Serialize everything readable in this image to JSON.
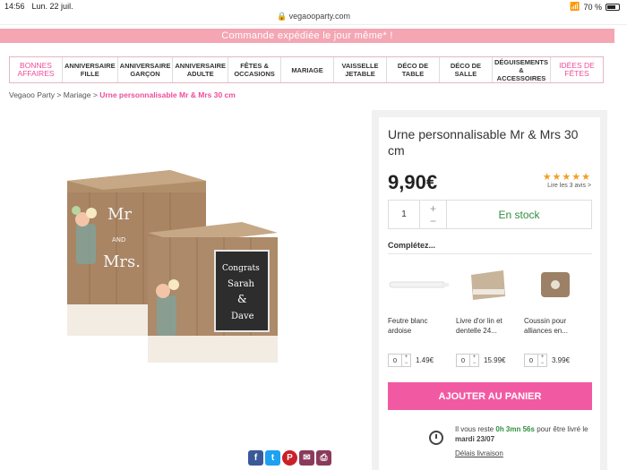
{
  "status": {
    "time": "14:56",
    "date": "Lun. 22 juil.",
    "url": "vegaooparty.com",
    "battery": "70 %"
  },
  "promo": "Commande expédiée le jour même* !",
  "nav": [
    {
      "label": "BONNES AFFAIRES",
      "pink": true
    },
    {
      "label": "ANNIVERSAIRE FILLE"
    },
    {
      "label": "ANNIVERSAIRE GARÇON"
    },
    {
      "label": "ANNIVERSAIRE ADULTE"
    },
    {
      "label": "FÊTES & OCCASIONS"
    },
    {
      "label": "MARIAGE"
    },
    {
      "label": "VAISSELLE JETABLE"
    },
    {
      "label": "DÉCO DE TABLE"
    },
    {
      "label": "DÉCO DE SALLE"
    },
    {
      "label": "DÉGUISEMENTS & ACCESSOIRES"
    },
    {
      "label": "IDÉES DE FÊTES",
      "pink": true
    }
  ],
  "breadcrumb": {
    "home": "Vegaoo Party",
    "sep": ">",
    "category": "Mariage",
    "current": "Urne personnalisable Mr & Mrs 30 cm"
  },
  "product": {
    "title": "Urne personnalisable Mr & Mrs 30 cm",
    "price": "9,90€",
    "stars": "★★★★★",
    "rating": 5,
    "reviews": "Lire les 3 avis >",
    "qty": "1",
    "plus": "+",
    "minus": "−",
    "stock": "En stock",
    "image_text": {
      "mr": "Mr",
      "and": "AND",
      "mrs": "Mrs.",
      "congrats": "Congrats",
      "name1": "Sarah",
      "amp": "&",
      "name2": "Dave"
    }
  },
  "completez": "Complétez...",
  "addons": [
    {
      "name": "Feutre blanc ardoise",
      "qty": "0",
      "price": "1.49€"
    },
    {
      "name": "Livre d'or lin et dentelle 24...",
      "qty": "0",
      "price": "15.99€"
    },
    {
      "name": "Coussin pour alliances en...",
      "qty": "0",
      "price": "3.99€"
    }
  ],
  "add_to_cart": "AJOUTER AU PANIER",
  "delivery": {
    "before": "Il vous reste",
    "countdown": "0h 3mn 56s",
    "after": "pour être livré le",
    "day": "mardi 23/07",
    "link": "Délais livraison"
  },
  "colors": {
    "pink": "#ee4d9b",
    "button": "#f15aa2",
    "green": "#2f8f3f",
    "star": "#f0a020"
  }
}
